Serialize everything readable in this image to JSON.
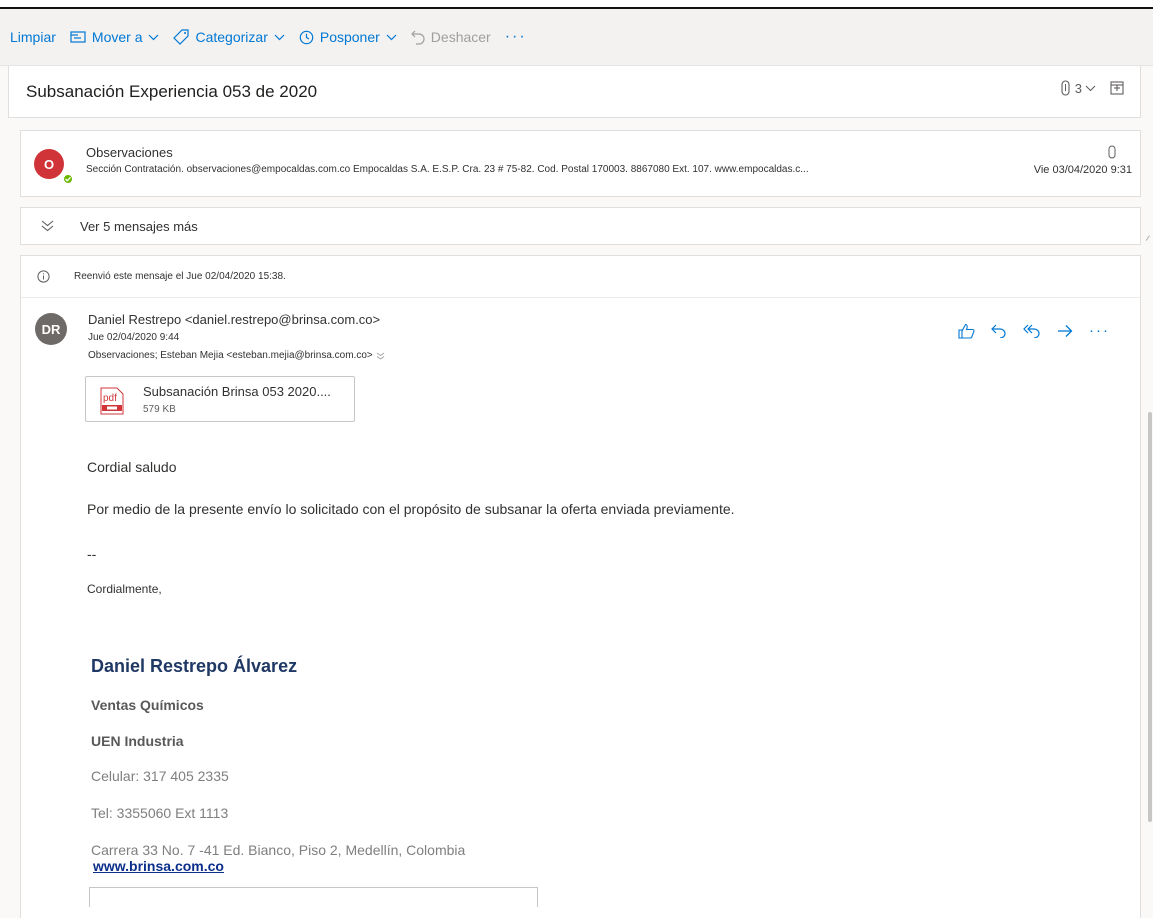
{
  "toolbar": {
    "clean": "Limpiar",
    "move_to": "Mover a",
    "categorize": "Categorizar",
    "snooze": "Posponer",
    "undo": "Deshacer",
    "more": "···"
  },
  "subject": {
    "title": "Subsanación Experiencia 053 de 2020",
    "attachment_count": "3"
  },
  "collapsed_message": {
    "avatar_initial": "O",
    "sender": "Observaciones",
    "preview": "Sección Contratación. observaciones@empocaldas.com.co Empocaldas S.A. E.S.P. Cra. 23 # 75-82. Cod. Postal 170003. 8867080 Ext. 107. www.empocaldas.c...",
    "date": "Vie 03/04/2020 9:31"
  },
  "more_messages": {
    "label": "Ver 5 mensajes más"
  },
  "message": {
    "forward_notice": "Reenvió este mensaje el Jue 02/04/2020 15:38.",
    "avatar_initials": "DR",
    "sender": "Daniel Restrepo <daniel.restrepo@brinsa.com.co>",
    "date": "Jue 02/04/2020 9:44",
    "recipients": "Observaciones; Esteban Mejia <esteban.mejia@brinsa.com.co>",
    "attachment": {
      "icon_label": "pdf",
      "name": "Subsanación Brinsa 053 2020....",
      "size": "579 KB"
    },
    "body": {
      "greeting": "Cordial saludo",
      "paragraph": "Por medio de la presente envío lo solicitado con el propósito de subsanar la oferta enviada previamente.",
      "separator": "--",
      "closing": "Cordialmente,"
    },
    "signature": {
      "name": "Daniel Restrepo Álvarez",
      "role": "Ventas Químicos",
      "unit": "UEN Industria",
      "mobile": "Celular: 317 405 2335",
      "phone": "Tel: 3355060 Ext 1113",
      "address": "Carrera 33 No. 7 -41 Ed. Bianco, Piso 2, Medellín, Colombia",
      "website": "www.brinsa.com.co"
    }
  },
  "colors": {
    "accent": "#0078d4",
    "avatar_o": "#d13438",
    "avatar_dr": "#6e6a67",
    "presence": "#6bb700",
    "signature_name": "#1f3864"
  }
}
